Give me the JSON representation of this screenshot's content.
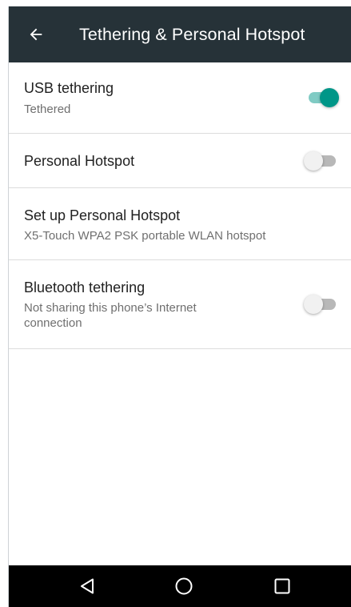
{
  "toolbar": {
    "title": "Tethering & Personal Hotspot",
    "back_icon": "arrow-left-icon",
    "background": "#263238"
  },
  "settings": [
    {
      "title": "USB tethering",
      "summary": "Tethered",
      "switch": {
        "state": "on"
      }
    },
    {
      "title": "Personal Hotspot",
      "summary": "",
      "switch": {
        "state": "off"
      }
    },
    {
      "title": "Set up Personal Hotspot",
      "summary": "X5-Touch WPA2 PSK portable WLAN hotspot",
      "switch": null
    },
    {
      "title": "Bluetooth tethering",
      "summary": "Not sharing this phone’s Internet connection",
      "switch": {
        "state": "off"
      }
    }
  ],
  "navbar": {
    "buttons": [
      "back-triangle-icon",
      "home-circle-icon",
      "recents-square-icon"
    ]
  },
  "colors": {
    "accent": "#009688",
    "accent_track": "#80cbc4",
    "title_text": "#212121",
    "summary_text": "#6f6f6f"
  }
}
